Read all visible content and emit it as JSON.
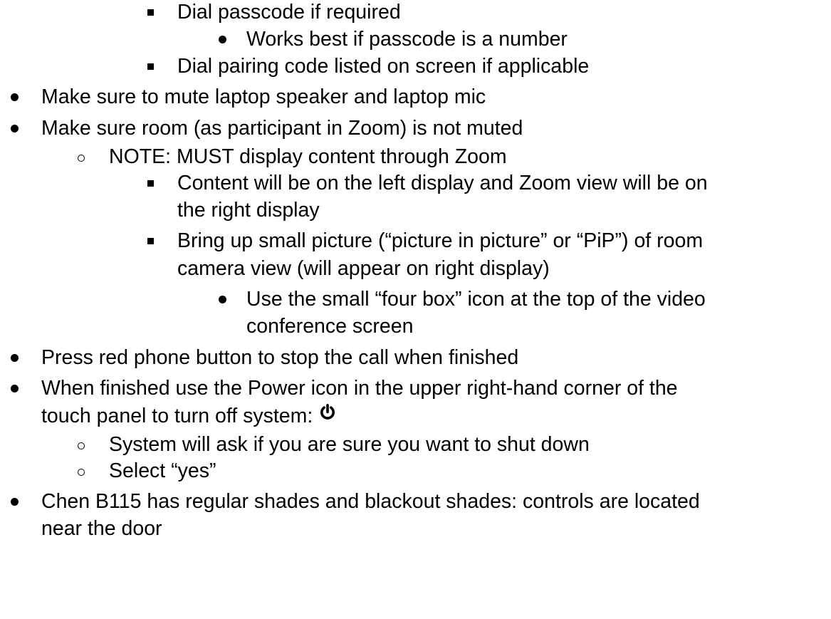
{
  "lines": [
    {
      "level": 3,
      "text": "Dial passcode if required"
    },
    {
      "level": 4,
      "text": "Works best if passcode is a number"
    },
    {
      "level": 3,
      "text": "Dial pairing code listed on screen if applicable"
    },
    {
      "level": 1,
      "text": "Make sure to mute laptop speaker and laptop mic"
    },
    {
      "level": 1,
      "text": "Make sure room (as participant in Zoom) is not muted"
    },
    {
      "level": 2,
      "text": "NOTE: MUST display content through Zoom"
    },
    {
      "level": 3,
      "text": "Content will be on the left display and Zoom view will be on"
    },
    {
      "level": 3,
      "text": "the right display"
    },
    {
      "level": 3,
      "text": "Bring up small picture (“picture in picture” or “PiP”) of room"
    },
    {
      "level": 3,
      "text": "camera view (will appear on right display)"
    },
    {
      "level": 4,
      "text": "Use the small “four box” icon at the top of the video"
    },
    {
      "level": 4,
      "text": "conference screen"
    },
    {
      "level": 1,
      "text": "Press red phone button to stop the call when finished"
    },
    {
      "level": 1,
      "text": "When finished use the Power icon in the upper right-hand corner of the"
    },
    {
      "level": 1,
      "text": "touch panel to turn off system:"
    },
    {
      "level": 2,
      "text": "System will ask if you are sure you want to shut down"
    },
    {
      "level": 2,
      "text": "Select “yes”"
    },
    {
      "level": 1,
      "text": "Chen B115 has regular shades and blackout shades: controls are located"
    },
    {
      "level": 1,
      "text": "near the door"
    }
  ],
  "icons": {
    "power": "power-icon"
  }
}
